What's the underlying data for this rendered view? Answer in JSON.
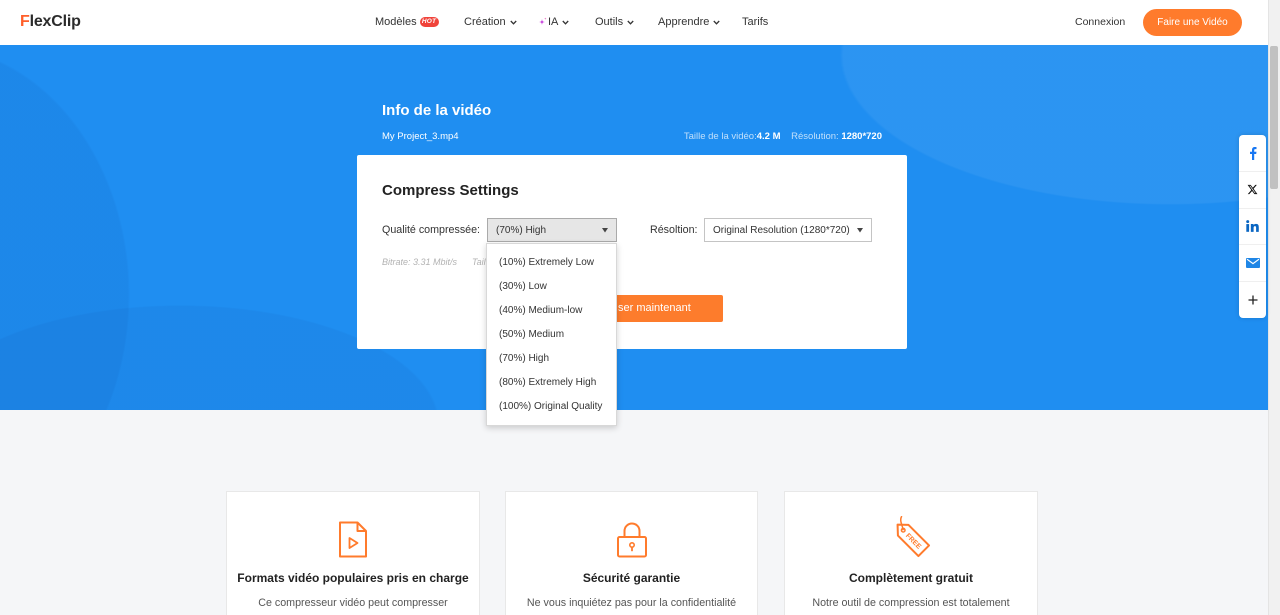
{
  "header": {
    "logo": "FlexClip",
    "nav": [
      {
        "label": "Modèles",
        "badge": "HOT"
      },
      {
        "label": "Création",
        "icon": "chevron-down-icon"
      },
      {
        "label": "IA",
        "icon": "sparkle-icon"
      },
      {
        "label": "Outils",
        "icon": "chevron-down-icon"
      },
      {
        "label": "Apprendre",
        "icon": "chevron-down-icon"
      },
      {
        "label": "Tarifs"
      }
    ],
    "login": "Connexion",
    "cta": "Faire une Vidéo"
  },
  "video_info": {
    "title": "Info de la vidéo",
    "filename": "My Project_3.mp4",
    "size_label": "Taille de la vidéo:",
    "size_value": "4.2 M",
    "resolution_label": "Résolution:",
    "resolution_value": "1280*720"
  },
  "settings": {
    "title": "Compress Settings",
    "quality_label": "Qualité compressée:",
    "quality_selected": "(70%) High",
    "resolution_label": "Résoltion:",
    "resolution_selected": "Original Resolution (1280*720)",
    "bitrate": "Bitrate: 3.31 Mbit/s",
    "size_hint": "Tail",
    "compress_button": "ser maintenant",
    "quality_options": [
      "(10%) Extremely Low",
      "(30%) Low",
      "(40%) Medium-low",
      "(50%) Medium",
      "(70%) High",
      "(80%) Extremely High",
      "(100%) Original Quality"
    ]
  },
  "share_bar": [
    {
      "icon": "facebook-icon"
    },
    {
      "icon": "x-icon"
    },
    {
      "icon": "linkedin-icon"
    },
    {
      "icon": "email-icon"
    },
    {
      "icon": "plus-icon"
    }
  ],
  "features": [
    {
      "icon": "video-file-icon",
      "title": "Formats vidéo populaires pris en charge",
      "description": "Ce compresseur vidéo peut compresser"
    },
    {
      "icon": "padlock-icon",
      "title": "Sécurité garantie",
      "description": "Ne vous inquiétez pas pour la confidentialité"
    },
    {
      "icon": "free-tag-icon",
      "icon_text": "FREE",
      "title": "Complètement gratuit",
      "description": "Notre outil de compression est totalement"
    }
  ],
  "colors": {
    "brand_orange": "#ff7b2c",
    "hero_blue": "#1f8ef1",
    "badge_red": "#f0433a",
    "facebook_blue": "#1877f2",
    "linkedin_blue": "#0a66c2"
  }
}
